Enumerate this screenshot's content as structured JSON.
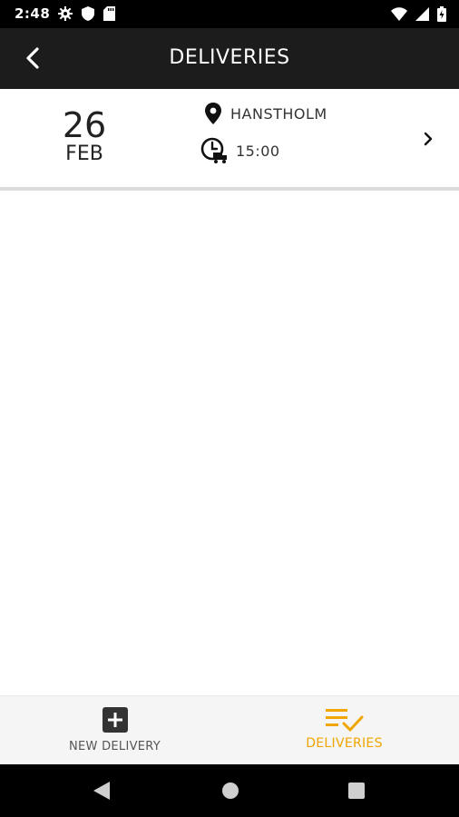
{
  "status_bar": {
    "time": "2:48",
    "icons": [
      "gear-icon",
      "shield-icon",
      "sd-card-icon",
      "wifi-icon",
      "signal-icon",
      "battery-icon"
    ]
  },
  "app_bar": {
    "title": "DELIVERIES",
    "back_icon": "back-chevron-icon"
  },
  "delivery": {
    "day": "26",
    "month": "FEB",
    "location": "HANSTHOLM",
    "time": "15:00",
    "location_icon": "location-pin-icon",
    "time_icon": "clock-truck-icon",
    "chevron_icon": "chevron-right-icon"
  },
  "bottom_nav": {
    "items": [
      {
        "label": "NEW DELIVERY",
        "icon": "add-box-icon",
        "active": false
      },
      {
        "label": "DELIVERIES",
        "icon": "list-check-icon",
        "active": true
      }
    ]
  },
  "colors": {
    "accent": "#f0a500",
    "app_bar": "#1c1c1c",
    "status_bar": "#000000",
    "nav_bg": "#f5f5f5"
  },
  "system_nav": {
    "icons": [
      "back-triangle-icon",
      "home-circle-icon",
      "recents-square-icon"
    ]
  }
}
